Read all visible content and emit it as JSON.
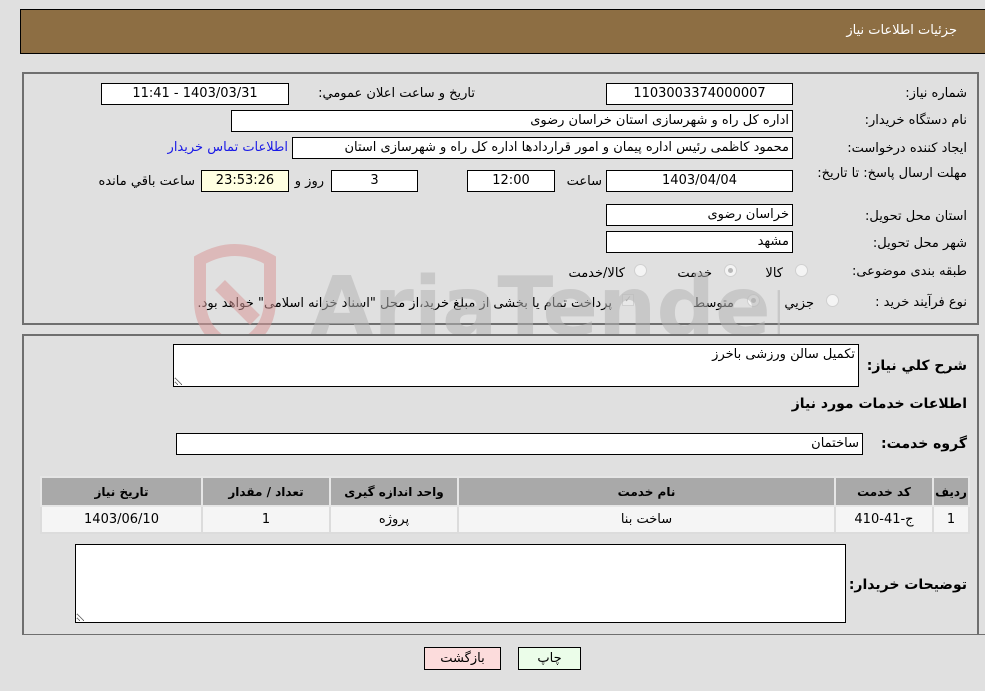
{
  "header": {
    "title": "جزئیات اطلاعات نیاز"
  },
  "form": {
    "need_number": {
      "label": "شماره نیاز:",
      "value": "1103003374000007"
    },
    "announce_datetime": {
      "label": "تاریخ و ساعت اعلان عمومي:",
      "value": "1403/03/31 - 11:41"
    },
    "buyer_org": {
      "label": "نام دستگاه خریدار:",
      "value": "اداره کل راه و شهرسازی استان خراسان رضوی"
    },
    "requester": {
      "label": "ایجاد کننده درخواست:",
      "value": "محمود کاظمی رئیس اداره پیمان و امور قراردادها اداره کل راه و شهرسازی استان"
    },
    "buyer_contact_link": "اطلاعات تماس خریدار",
    "deadline": {
      "label": "مهلت ارسال پاسخ: تا تاریخ:",
      "date": "1403/04/04",
      "time_label": "ساعت",
      "time": "12:00",
      "days": "3",
      "days_label": "روز و",
      "remaining": "23:53:26",
      "remaining_label": "ساعت باقي مانده"
    },
    "delivery_province": {
      "label": "استان محل تحویل:",
      "value": "خراسان رضوی"
    },
    "delivery_city": {
      "label": "شهر محل تحویل:",
      "value": "مشهد"
    },
    "category": {
      "label": "طبقه بندی موضوعی:",
      "options": [
        "کالا",
        "خدمت",
        "کالا/خدمت"
      ],
      "selected": "خدمت"
    },
    "purchase_type": {
      "label": "نوع فرآیند خرید :",
      "options": [
        "جزيي",
        "متوسط"
      ],
      "selected": "متوسط",
      "treasury_note": "پرداخت تمام یا بخشی از مبلغ خرید،از محل \"اسناد خزانه اسلامی\" خواهد بود.",
      "treasury_checked": true
    }
  },
  "details": {
    "description_label": "شرح کلي نیاز:",
    "description": "تکمیل سالن ورزشی باخرز",
    "services_title": "اطلاعات خدمات مورد نیاز",
    "service_group_label": "گروه خدمت:",
    "service_group": "ساختمان",
    "table": {
      "headers": [
        "ردیف",
        "کد خدمت",
        "نام خدمت",
        "واحد اندازه گیری",
        "تعداد / مقدار",
        "تاریخ نیاز"
      ],
      "rows": [
        [
          "1",
          "ج-41-410",
          "ساخت بنا",
          "پروژه",
          "1",
          "1403/06/10"
        ]
      ]
    },
    "buyer_notes_label": "توضیحات خریدار:",
    "buyer_notes": ""
  },
  "buttons": {
    "print": "چاپ",
    "back": "بازگشت"
  },
  "watermark": {
    "text": "AriaTender.neT"
  }
}
